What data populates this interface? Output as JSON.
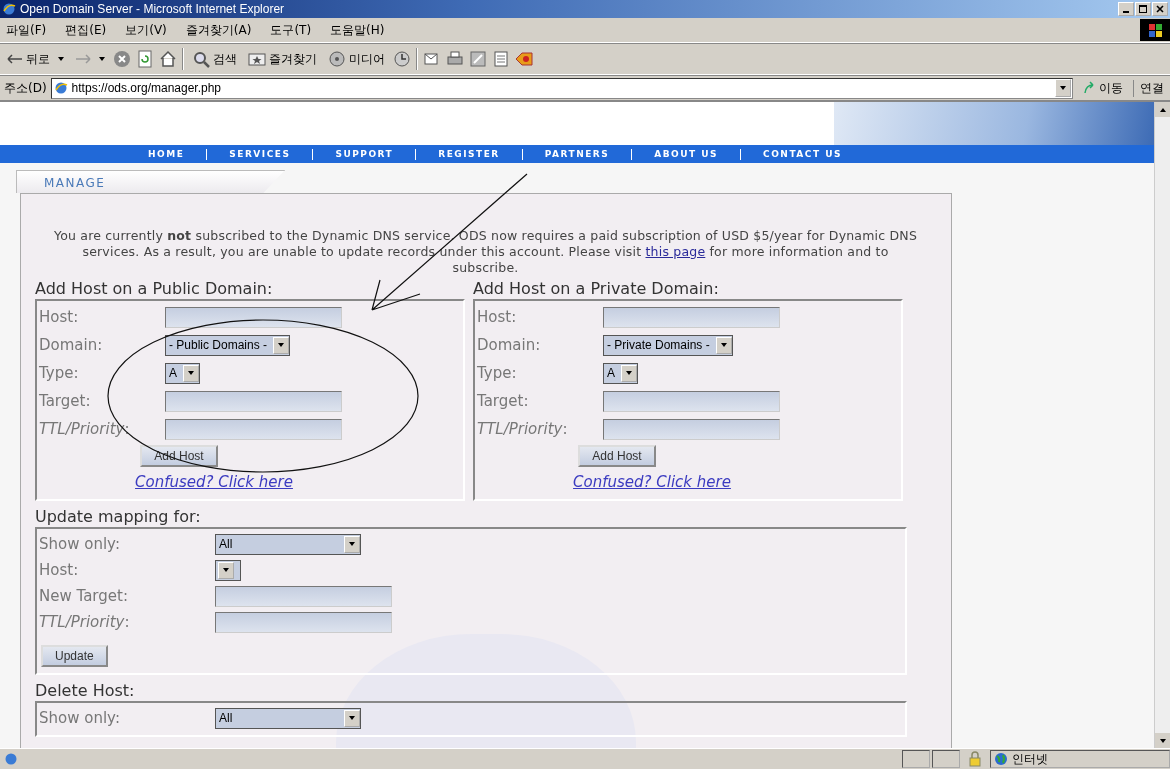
{
  "window": {
    "title": "Open Domain Server - Microsoft Internet Explorer"
  },
  "menu_bar": [
    "파일(F)",
    "편집(E)",
    "보기(V)",
    "즐겨찾기(A)",
    "도구(T)",
    "도움말(H)"
  ],
  "toolbar": {
    "back": "뒤로",
    "search": "검색",
    "favorites": "즐겨찾기",
    "media": "미디어"
  },
  "address_bar": {
    "label": "주소(D)",
    "url": "https://ods.org/manager.php",
    "go": "이동",
    "links": "연결"
  },
  "nav": [
    "HOME",
    "SERVICES",
    "SUPPORT",
    "REGISTER",
    "PARTNERS",
    "ABOUT US",
    "CONTACT US"
  ],
  "manage_tab": "MANAGE",
  "notice": {
    "before": "You are currently **not** subscribed to the Dynamic DNS service. ODS now requires a paid subscription of USD $5/year for Dynamic DNS services. As a result, you are unable to update records under this account. Please visit",
    "link": "this page",
    "after": "for more information and to subscribe."
  },
  "add_sections": [
    {
      "title": "Add Host on a Public Domain:",
      "fields": [
        {
          "label": "Host:",
          "kind": "text"
        },
        {
          "label": "Domain:",
          "kind": "select",
          "value": "- Public Domains -"
        },
        {
          "label": "Type:",
          "kind": "select",
          "value": "A"
        },
        {
          "label": "Target:",
          "kind": "text"
        },
        {
          "label": "*TTL/Priority*:",
          "kind": "text"
        }
      ],
      "button": "Add Host",
      "help_link": "Confused? Click here"
    },
    {
      "title": "Add Host on a Private Domain:",
      "fields": [
        {
          "label": "Host:",
          "kind": "text"
        },
        {
          "label": "Domain:",
          "kind": "select",
          "value": "- Private Domains -"
        },
        {
          "label": "Type:",
          "kind": "select",
          "value": "A"
        },
        {
          "label": "Target:",
          "kind": "text"
        },
        {
          "label": "*TTL/Priority*:",
          "kind": "text"
        }
      ],
      "button": "Add Host",
      "help_link": "Confused? Click here"
    }
  ],
  "update_section": {
    "title": "Update mapping for:",
    "fields": [
      {
        "label": "Show only:",
        "kind": "wideselect",
        "value": "All"
      },
      {
        "label": "Host:",
        "kind": "tinyselect"
      },
      {
        "label": "New Target:",
        "kind": "text"
      },
      {
        "label": "*TTL/Priority*:",
        "kind": "text"
      }
    ],
    "button": "Update"
  },
  "delete_section": {
    "title": "Delete Host:",
    "fields": [
      {
        "label": "Show only:",
        "kind": "wideselect",
        "value": "All"
      }
    ]
  },
  "status_bar": {
    "zone": "인터넷"
  }
}
